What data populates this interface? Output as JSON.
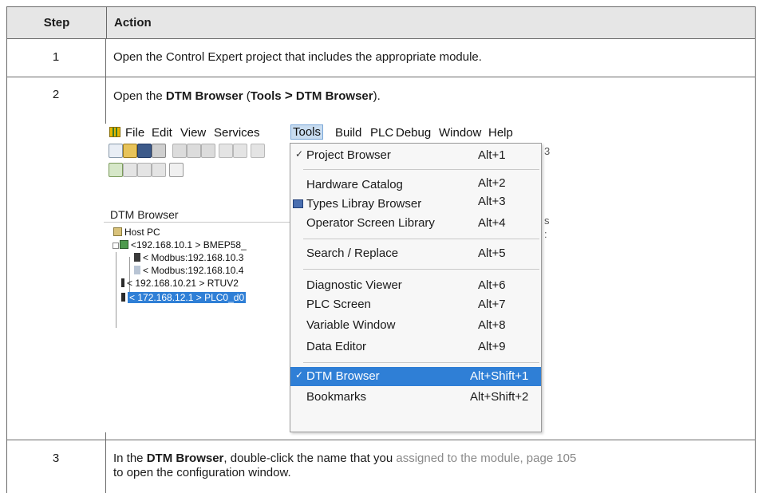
{
  "table": {
    "header": {
      "step": "Step",
      "action": "Action"
    },
    "rows": [
      {
        "step": "1",
        "text": "Open the Control Expert project that includes the appropriate module."
      },
      {
        "step": "2",
        "t1": "Open the ",
        "b1": "DTM Browser",
        "t2": " (",
        "b2": "Tools",
        "gt": ">",
        "b3": "DTM Browser",
        "t3": ")."
      },
      {
        "step": "3",
        "t1": "In the ",
        "b1": "DTM Browser",
        "t2": ", double-click the name that you ",
        "link": "assigned to the module, page 105",
        "t3": "to open the configuration window."
      }
    ]
  },
  "screenshot": {
    "menu": [
      "File",
      "Edit",
      "View",
      "Services",
      "Tools",
      "Build",
      "PLC",
      "Debug",
      "Window",
      "Help"
    ],
    "selected_menu": "Tools",
    "panel_title": "DTM Browser",
    "tree": [
      {
        "label": "Host PC"
      },
      {
        "label": "<192.168.10.1 > BMEP58_"
      },
      {
        "label": "< Modbus:192.168.10.3"
      },
      {
        "label": "< Modbus:192.168.10.4"
      },
      {
        "label": "< 192.168.10.21 > RTUV2"
      },
      {
        "label": "< 172.168.12.1 > PLC0_d0",
        "selected": true
      }
    ],
    "dropdown": [
      {
        "label": "Project Browser",
        "shortcut": "Alt+1",
        "checked": true
      },
      {
        "label": "Hardware Catalog",
        "shortcut": "Alt+2"
      },
      {
        "label": "Types Libray Browser",
        "shortcut": "Alt+3",
        "icon": "library-icon"
      },
      {
        "label": "Operator Screen Library",
        "shortcut": "Alt+4"
      },
      {
        "label": "Search / Replace",
        "shortcut": "Alt+5"
      },
      {
        "label": "Diagnostic Viewer",
        "shortcut": "Alt+6"
      },
      {
        "label": "PLC Screen",
        "shortcut": "Alt+7"
      },
      {
        "label": "Variable Window",
        "shortcut": "Alt+8"
      },
      {
        "label": "Data Editor",
        "shortcut": "Alt+9"
      },
      {
        "label": "DTM Browser",
        "shortcut": "Alt+Shift+1",
        "checked": true,
        "highlighted": true
      },
      {
        "label": "Bookmarks",
        "shortcut": "Alt+Shift+2"
      }
    ],
    "fragments": {
      "toolbar_edge": "3",
      "panel_edge": "s",
      "panel_edge2": ":"
    }
  },
  "colors": {
    "highlight": "#2f7fd6",
    "header_bg": "#e6e6e6",
    "border": "#6a6a6a"
  }
}
